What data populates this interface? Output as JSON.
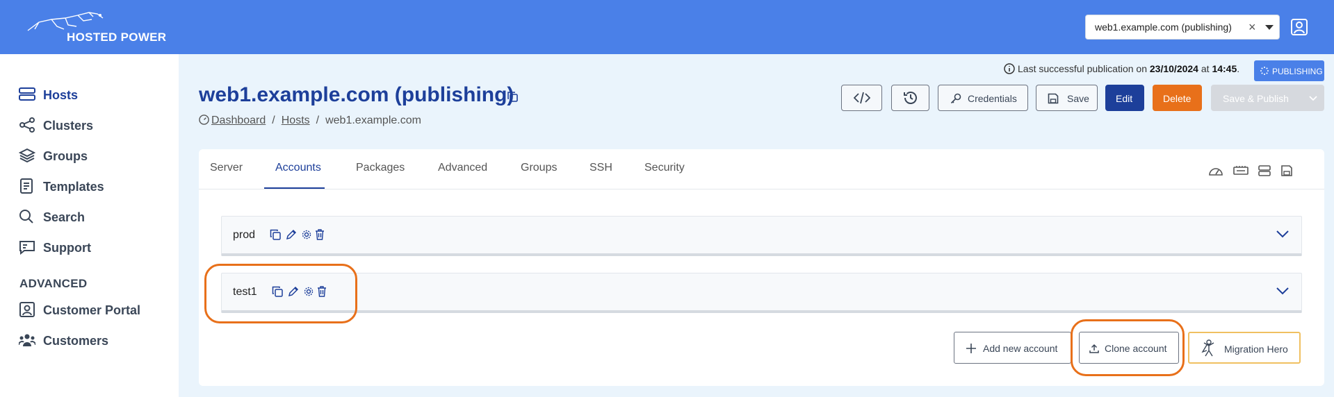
{
  "brand": {
    "name": "HOSTED POWER"
  },
  "host_selector": {
    "value": "web1.example.com (publishing)",
    "clear": "×"
  },
  "sidebar": {
    "items": [
      {
        "label": "Hosts"
      },
      {
        "label": "Clusters"
      },
      {
        "label": "Groups"
      },
      {
        "label": "Templates"
      },
      {
        "label": "Search"
      },
      {
        "label": "Support"
      }
    ],
    "advanced_heading": "ADVANCED",
    "advanced_items": [
      {
        "label": "Customer Portal"
      },
      {
        "label": "Customers"
      }
    ]
  },
  "publication": {
    "text": "Last successful publication on ",
    "date": "23/10/2024",
    "at": " at ",
    "time": "14:45",
    "end": ".",
    "badge": "PUBLISHING"
  },
  "page": {
    "title": "web1.example.com (publishing)",
    "breadcrumb": [
      "Dashboard",
      "Hosts",
      "web1.example.com"
    ],
    "separator": "/"
  },
  "toolbar": {
    "credentials": "Credentials",
    "save": "Save",
    "edit": "Edit",
    "delete": "Delete",
    "save_publish": "Save & Publish"
  },
  "tabs": [
    "Server",
    "Accounts",
    "Packages",
    "Advanced",
    "Groups",
    "SSH",
    "Security"
  ],
  "accounts": [
    {
      "name": "prod"
    },
    {
      "name": "test1"
    }
  ],
  "actions": {
    "add": "Add new account",
    "clone": "Clone account",
    "migration": "Migration Hero"
  },
  "colors": {
    "topbar": "#4a80e8",
    "primary": "#1d3f9a",
    "danger": "#e8701a",
    "highlight_ring": "#e8701a"
  }
}
